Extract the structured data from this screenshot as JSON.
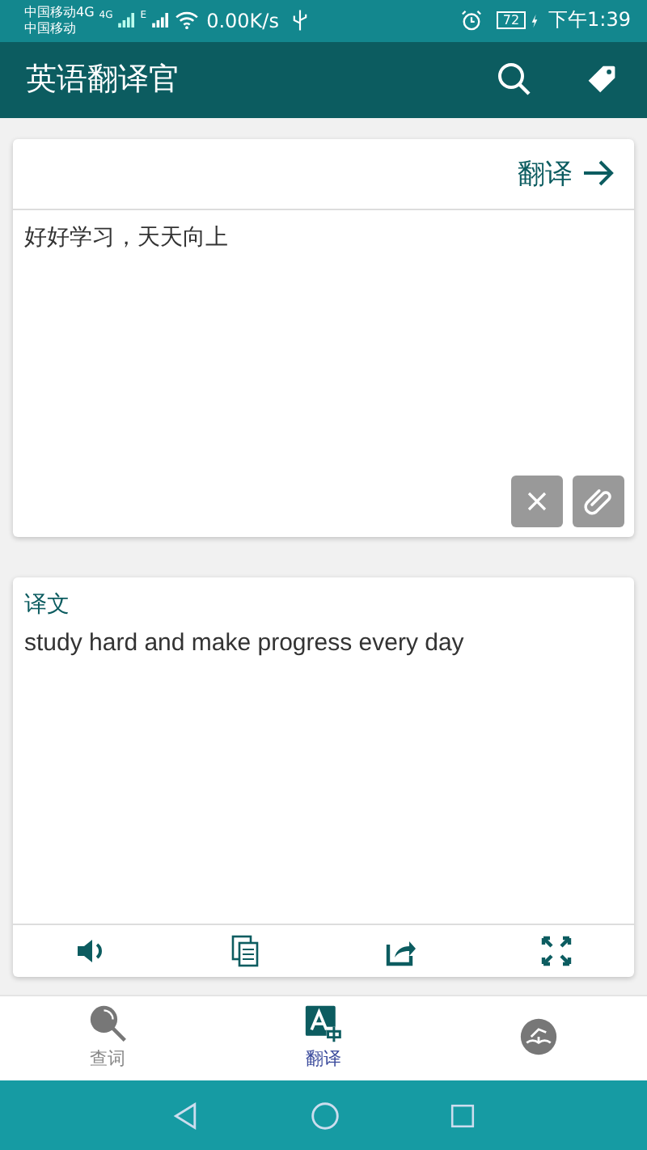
{
  "status_bar": {
    "carrier_1": "中国移动4G",
    "carrier_2": "中国移动",
    "net_type_1": "4G",
    "net_type_2": "E",
    "speed": "0.00K/s",
    "battery": "72",
    "time": "下午1:39"
  },
  "app_bar": {
    "title": "英语翻译官"
  },
  "input_card": {
    "translate_button": "翻译",
    "text": "好好学习，天天向上"
  },
  "output_card": {
    "label": "译文",
    "text": "study hard and make progress every day"
  },
  "bottom_nav": [
    {
      "label": "查词",
      "kind": "lookup",
      "selected": false
    },
    {
      "label": "翻译",
      "kind": "translate",
      "selected": true
    },
    {
      "kind": "study",
      "selected": false
    }
  ]
}
